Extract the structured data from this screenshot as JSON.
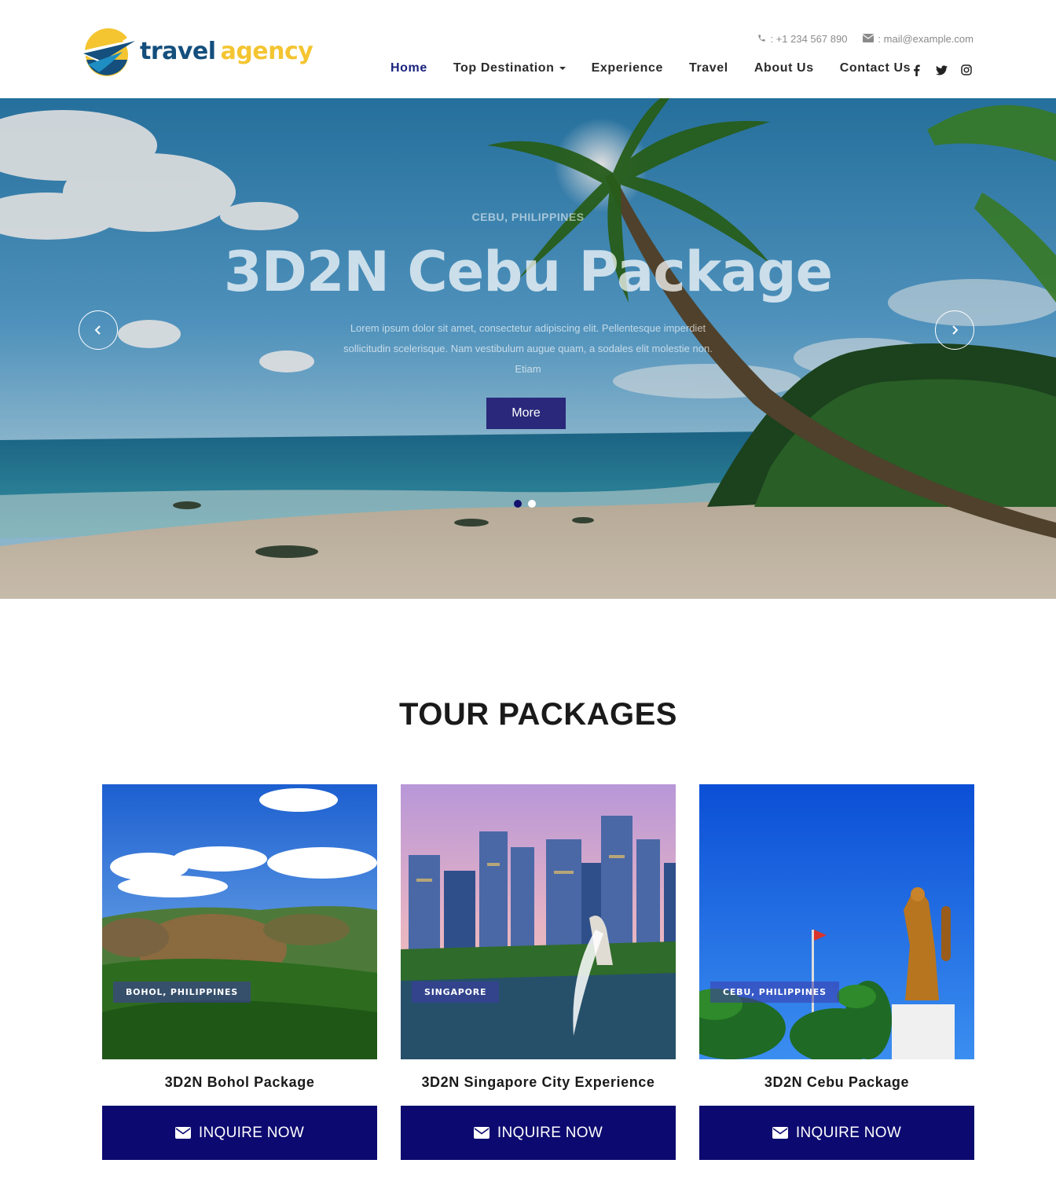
{
  "brand": {
    "name_part1": "travel",
    "name_part2": "agency",
    "colors": {
      "primary": "#144f7d",
      "accent": "#f4c531",
      "nav_active": "#1a237e",
      "button": "#0c0970"
    }
  },
  "topbar": {
    "phone": ": +1 234 567 890",
    "email": ": mail@example.com",
    "phone_icon": "phone-icon",
    "email_icon": "envelope-icon"
  },
  "nav": {
    "items": [
      {
        "label": "Home",
        "active": true
      },
      {
        "label": "Top Destination",
        "dropdown": true
      },
      {
        "label": "Experience"
      },
      {
        "label": "Travel"
      },
      {
        "label": "About Us"
      },
      {
        "label": "Contact Us"
      }
    ]
  },
  "social": [
    "facebook-icon",
    "twitter-icon",
    "instagram-icon"
  ],
  "hero": {
    "subtitle": "CEBU, PHILIPPINES",
    "title": "3D2N Cebu Package",
    "text": "Lorem ipsum dolor sit amet, consectetur adipiscing elit. Pellentesque imperdiet sollicitudin scelerisque. Nam vestibulum augue quam, a sodales elit molestie non. Etiam",
    "button": "More",
    "slides": 2,
    "active_slide": 1
  },
  "packages": {
    "title": "TOUR PACKAGES",
    "items": [
      {
        "tag": "BOHOL, PHILIPPINES",
        "name": "3D2N Bohol Package",
        "button": "INQUIRE NOW"
      },
      {
        "tag": "SINGAPORE",
        "name": "3D2N Singapore City Experience",
        "button": "INQUIRE NOW"
      },
      {
        "tag": "CEBU, PHILIPPINES",
        "name": "3D2N Cebu Package",
        "button": "INQUIRE NOW"
      }
    ]
  }
}
